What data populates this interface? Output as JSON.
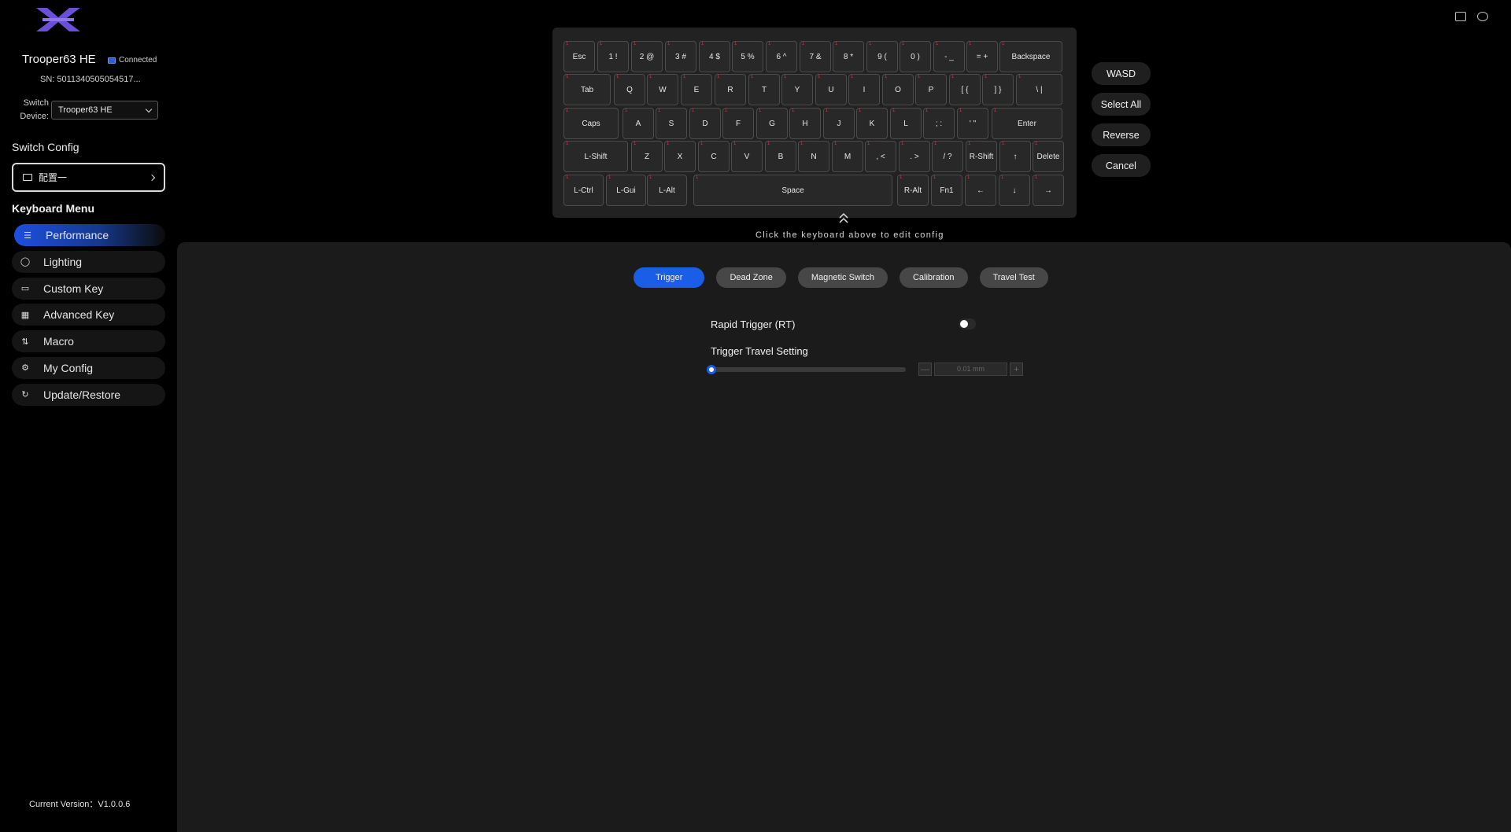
{
  "sidebar": {
    "device_name": "Trooper63 HE",
    "connection_status": "Connected",
    "serial": "SN: 5011340505054517...",
    "switch_device_label_1": "Switch",
    "switch_device_label_2": "Device:",
    "selected_device": "Trooper63 HE",
    "switch_config_title": "Switch Config",
    "current_config": "配置一",
    "keyboard_menu_title": "Keyboard Menu",
    "menu_items": [
      {
        "label": "Performance",
        "icon": "sliders-icon"
      },
      {
        "label": "Lighting",
        "icon": "bulb-icon"
      },
      {
        "label": "Custom Key",
        "icon": "keyboard-icon"
      },
      {
        "label": "Advanced Key",
        "icon": "grid-icon"
      },
      {
        "label": "Macro",
        "icon": "macro-icon"
      },
      {
        "label": "My Config",
        "icon": "gear-icon"
      },
      {
        "label": "Update/Restore",
        "icon": "refresh-icon"
      }
    ],
    "version": "Current Version：V1.0.0.6"
  },
  "keyboard": {
    "rows": [
      [
        "Esc",
        "1 !",
        "2 @",
        "3 #",
        "4 $",
        "5 %",
        "6 ^",
        "7 &",
        "8 *",
        "9 (",
        "0 )",
        "- _",
        "= +",
        "Backspace"
      ],
      [
        "Tab",
        "Q",
        "W",
        "E",
        "R",
        "T",
        "Y",
        "U",
        "I",
        "O",
        "P",
        "[ {",
        "] }",
        "\\ |"
      ],
      [
        "Caps",
        "A",
        "S",
        "D",
        "F",
        "G",
        "H",
        "J",
        "K",
        "L",
        "; :",
        "' \"",
        "Enter"
      ],
      [
        "L-Shift",
        "Z",
        "X",
        "C",
        "V",
        "B",
        "N",
        "M",
        ", <",
        ". >",
        "/ ?",
        "R-Shift",
        "↑",
        "Delete"
      ],
      [
        "L-Ctrl",
        "L-Gui",
        "L-Alt",
        "Space",
        "R-Alt",
        "Fn1",
        "←",
        "↓",
        "→"
      ]
    ],
    "hint": "Click the keyboard above to edit config"
  },
  "side_buttons": [
    "WASD",
    "Select All",
    "Reverse",
    "Cancel"
  ],
  "tabs": [
    "Trigger",
    "Dead Zone",
    "Magnetic Switch",
    "Calibration",
    "Travel Test"
  ],
  "active_tab": "Trigger",
  "settings": {
    "rapid_trigger_label": "Rapid Trigger (RT)",
    "rapid_trigger_on": false,
    "trigger_travel_label": "Trigger Travel Setting",
    "travel_value": "0.01 mm",
    "minus": "—",
    "plus": "+"
  }
}
